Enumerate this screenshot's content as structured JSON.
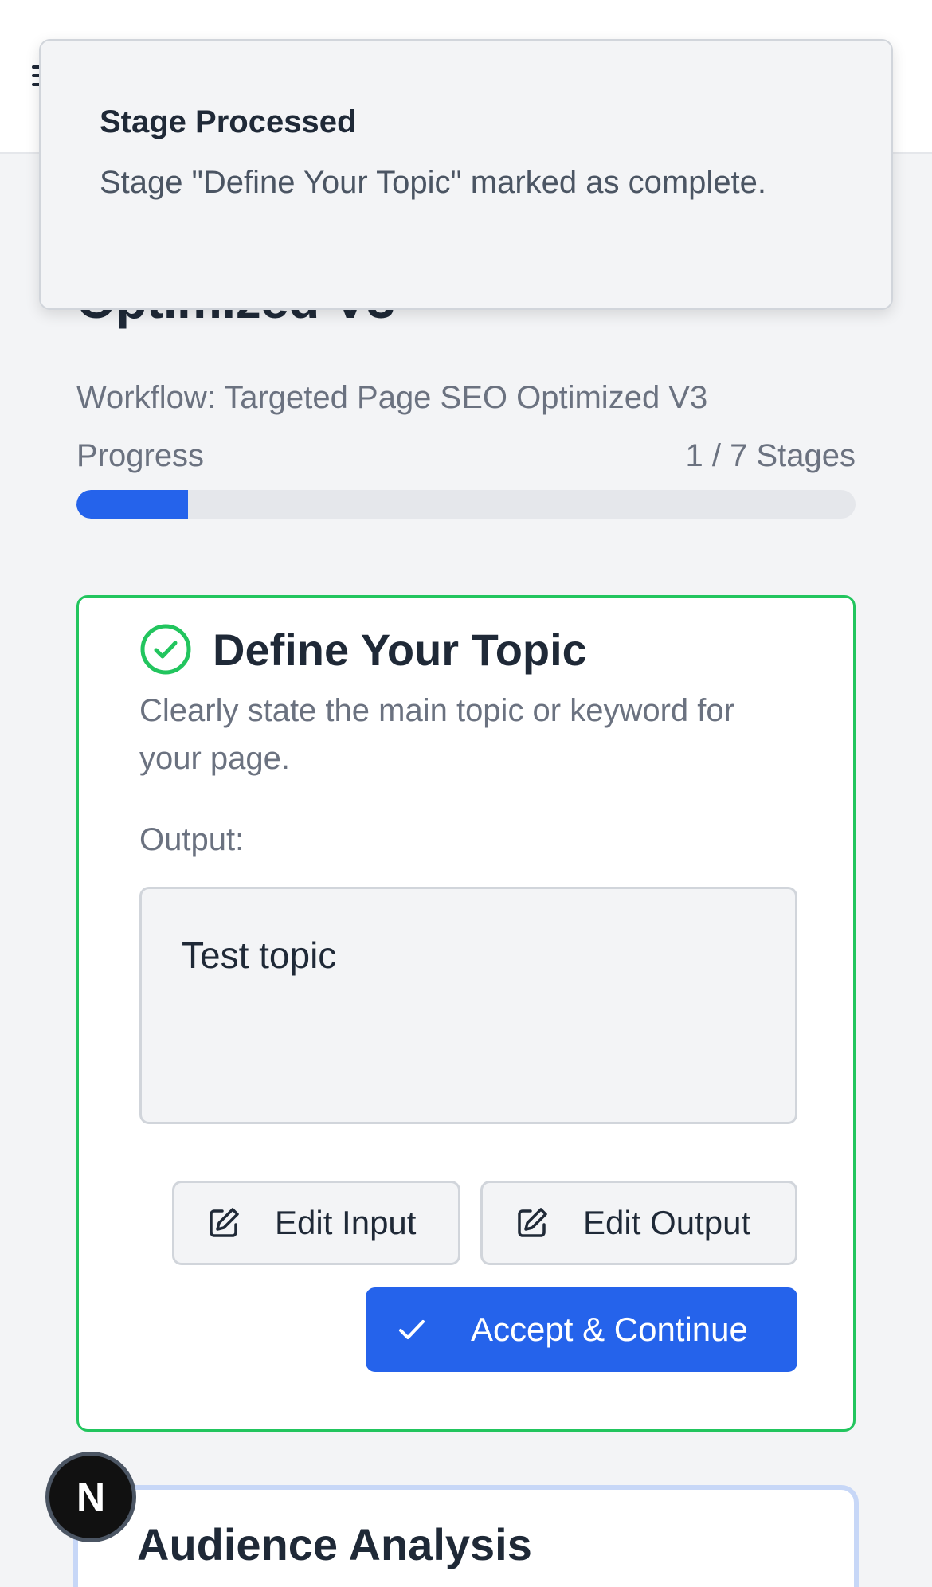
{
  "header": {
    "menu_icon": "menu-icon"
  },
  "page": {
    "title": "Optimized V3",
    "workflow_line": "Workflow: Targeted Page SEO Optimized V3",
    "progress_label": "Progress",
    "progress_count": "1 / 7 Stages",
    "progress_fraction": 0.1429
  },
  "stage": {
    "status_icon": "check-circle-icon",
    "title": "Define Your Topic",
    "description": "Clearly state the main topic or keyword for your page.",
    "output_label": "Output:",
    "output_value": "Test topic",
    "edit_input_label": "Edit Input",
    "edit_output_label": "Edit Output",
    "accept_label": "Accept & Continue",
    "border_color": "#22c55e"
  },
  "next_stage": {
    "title": "Audience Analysis"
  },
  "badge": {
    "letter": "N"
  },
  "toast": {
    "title": "Stage Processed",
    "message": "Stage \"Define Your Topic\" marked as complete."
  },
  "colors": {
    "accent": "#2563eb",
    "success": "#22c55e"
  }
}
